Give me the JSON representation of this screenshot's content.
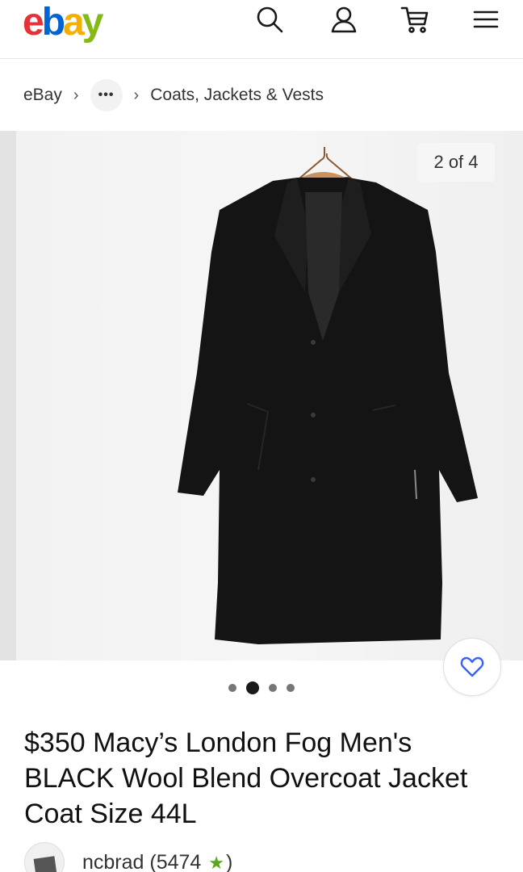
{
  "header": {
    "logo_letters": [
      "e",
      "b",
      "a",
      "y"
    ],
    "logo_colors": [
      "#e53238",
      "#0064d2",
      "#f5af02",
      "#86b817"
    ],
    "icons": [
      "search-icon",
      "account-icon",
      "cart-icon",
      "menu-icon"
    ]
  },
  "breadcrumb": {
    "root": "eBay",
    "more": "•••",
    "category": "Coats, Jackets & Vests",
    "separator": "›"
  },
  "gallery": {
    "counter": "2 of 4",
    "dots_total": 4,
    "dots_active_index": 1
  },
  "listing": {
    "title": "$350 Macy’s London Fog Men's BLACK Wool Blend Overcoat Jacket Coat Size 44L"
  },
  "seller": {
    "name": "ncbrad",
    "feedback_open": " (5474 ",
    "feedback_close": ")",
    "star_color": "#5ba71b"
  }
}
